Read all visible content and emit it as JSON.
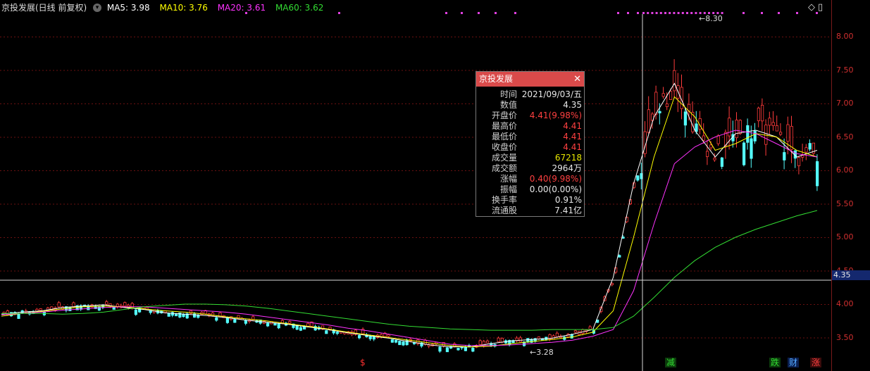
{
  "header": {
    "title": "京投发展(日线 前复权)",
    "ma": [
      {
        "label": "MA5: 3.98",
        "color": "#ffffff"
      },
      {
        "label": "MA10: 3.76",
        "color": "#ffff00"
      },
      {
        "label": "MA20: 3.61",
        "color": "#ff33ff"
      },
      {
        "label": "MA60: 3.62",
        "color": "#33dd33"
      }
    ]
  },
  "axis": {
    "ticks": [
      "8.00",
      "7.50",
      "7.00",
      "6.50",
      "6.00",
      "5.50",
      "5.00",
      "4.50",
      "4.00",
      "3.50"
    ]
  },
  "crosshair": {
    "price_label": "4.35"
  },
  "markers": {
    "high": "8.30",
    "low": "3.28"
  },
  "tooltip": {
    "title": "京投发展",
    "rows": [
      {
        "k": "时间",
        "v": "2021/09/03/五",
        "color": "#e8e8e8"
      },
      {
        "k": "数值",
        "v": "4.35",
        "color": "#e8e8e8"
      },
      {
        "k": "开盘价",
        "v": "4.41(9.98%)",
        "color": "#ff4040"
      },
      {
        "k": "最高价",
        "v": "4.41",
        "color": "#ff4040"
      },
      {
        "k": "最低价",
        "v": "4.41",
        "color": "#ff4040"
      },
      {
        "k": "收盘价",
        "v": "4.41",
        "color": "#ff4040"
      },
      {
        "k": "成交量",
        "v": "67218",
        "color": "#e6e600"
      },
      {
        "k": "成交额",
        "v": "2964万",
        "color": "#e8e8e8"
      },
      {
        "k": "涨幅",
        "v": "0.40(9.98%)",
        "color": "#ff4040"
      },
      {
        "k": "振幅",
        "v": "0.00(0.00%)",
        "color": "#e8e8e8"
      },
      {
        "k": "换手率",
        "v": "0.91%",
        "color": "#e8e8e8"
      },
      {
        "k": "流通股",
        "v": "7.41亿",
        "color": "#e8e8e8"
      }
    ]
  },
  "signals": [
    {
      "label": "$",
      "color": "#ff3030",
      "bg": "transparent"
    },
    {
      "label": "减",
      "color": "#33dd33",
      "bg": "#0b3a0b"
    },
    {
      "label": "跌",
      "color": "#33dd33",
      "bg": "#0b3a0b"
    },
    {
      "label": "财",
      "color": "#55aaff",
      "bg": "#0b2050"
    },
    {
      "label": "涨",
      "color": "#ff4040",
      "bg": "#3a0b0b"
    }
  ],
  "chart_data": {
    "type": "candlestick",
    "ylim": [
      3.2,
      8.45
    ],
    "series": [
      {
        "name": "MA5",
        "values": [
          3.85,
          3.88,
          3.9,
          3.95,
          3.97,
          3.99,
          3.95,
          3.92,
          3.87,
          3.85,
          3.83,
          3.8,
          3.76,
          3.73,
          3.7,
          3.66,
          3.62,
          3.57,
          3.53,
          3.49,
          3.44,
          3.39,
          3.36,
          3.36,
          3.41,
          3.45,
          3.47,
          3.49,
          3.55,
          3.62,
          4.4,
          5.8,
          6.8,
          7.3,
          6.6,
          6.2,
          6.55,
          6.6,
          6.5,
          6.2,
          6.3
        ]
      },
      {
        "name": "MA10",
        "values": [
          3.82,
          3.86,
          3.89,
          3.93,
          3.96,
          3.97,
          3.96,
          3.93,
          3.9,
          3.88,
          3.85,
          3.81,
          3.78,
          3.75,
          3.71,
          3.67,
          3.63,
          3.58,
          3.54,
          3.5,
          3.46,
          3.42,
          3.38,
          3.36,
          3.37,
          3.41,
          3.44,
          3.47,
          3.51,
          3.58,
          3.9,
          5.0,
          6.2,
          7.1,
          6.8,
          6.3,
          6.4,
          6.55,
          6.5,
          6.3,
          6.2
        ]
      },
      {
        "name": "MA20",
        "values": [
          3.84,
          3.86,
          3.88,
          3.91,
          3.93,
          3.95,
          3.96,
          3.96,
          3.94,
          3.92,
          3.9,
          3.88,
          3.85,
          3.81,
          3.77,
          3.73,
          3.69,
          3.64,
          3.6,
          3.55,
          3.5,
          3.45,
          3.4,
          3.38,
          3.38,
          3.39,
          3.41,
          3.43,
          3.46,
          3.52,
          3.62,
          4.2,
          5.2,
          6.1,
          6.35,
          6.5,
          6.6,
          6.55,
          6.4,
          6.25,
          6.2
        ]
      },
      {
        "name": "MA60",
        "values": [
          3.86,
          3.86,
          3.86,
          3.85,
          3.86,
          3.88,
          3.92,
          3.96,
          3.98,
          4.0,
          4.0,
          3.99,
          3.97,
          3.94,
          3.9,
          3.86,
          3.82,
          3.78,
          3.74,
          3.7,
          3.67,
          3.65,
          3.63,
          3.62,
          3.61,
          3.61,
          3.61,
          3.62,
          3.62,
          3.62,
          3.65,
          3.82,
          4.1,
          4.4,
          4.65,
          4.85,
          5.0,
          5.12,
          5.22,
          5.32,
          5.4
        ]
      }
    ]
  }
}
